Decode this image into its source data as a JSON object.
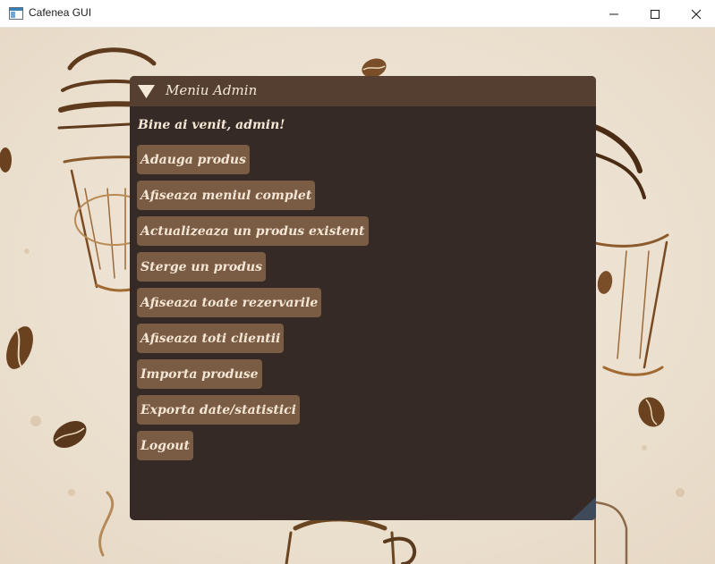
{
  "window": {
    "title": "Cafenea GUI",
    "minimize_icon": "minimize-icon",
    "maximize_icon": "maximize-icon",
    "close_icon": "close-icon"
  },
  "panel": {
    "title": "Meniu Admin",
    "header_icon": "collapse-triangle-icon",
    "welcome": "Bine ai venit, admin!",
    "buttons": [
      "Adauga produs",
      "Afiseaza meniul complet",
      "Actualizeaza un produs existent",
      "Sterge un produs",
      "Afiseaza toate rezervarile",
      "Afiseaza toti clientii",
      "Importa produse",
      "Exporta date/statistici",
      "Logout"
    ]
  },
  "colors": {
    "panel_bg": "#352a25",
    "header_bg": "#543f30",
    "button_bg": "#7a5b43",
    "text": "#f5e8d6",
    "background": "#efe6d8"
  }
}
